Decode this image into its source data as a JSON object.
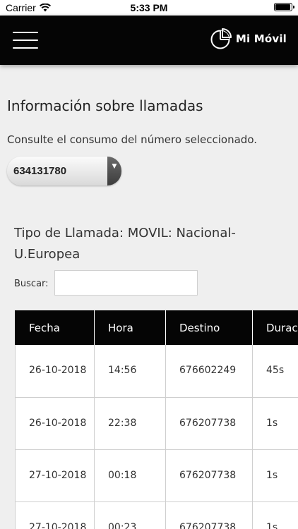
{
  "status_bar": {
    "carrier": "Carrier",
    "time": "5:33 PM",
    "battery_level": 0.95
  },
  "header": {
    "menu_icon": "hamburger-menu-icon",
    "logo_icon": "pie-chart-icon",
    "brand_name": "Mi Móvil",
    "background_color": "#050505"
  },
  "main": {
    "title": "Información sobre llamadas",
    "subtitle": "Consulte el consumo del número seleccionado.",
    "selected_number": "634131780"
  },
  "call_type": "Tipo de Llamada: MOVIL: Nacional-U.Europea",
  "search": {
    "label": "Buscar:",
    "value": "",
    "placeholder": ""
  },
  "table": {
    "columns": [
      "Fecha",
      "Hora",
      "Destino",
      "Duración"
    ],
    "rows": [
      [
        "26-10-2018",
        "14:56",
        "676602249",
        "45s"
      ],
      [
        "26-10-2018",
        "22:38",
        "676207738",
        "1s"
      ],
      [
        "27-10-2018",
        "00:18",
        "676207738",
        "1s"
      ],
      [
        "27-10-2018",
        "00:23",
        "676207738",
        "1s"
      ]
    ]
  }
}
